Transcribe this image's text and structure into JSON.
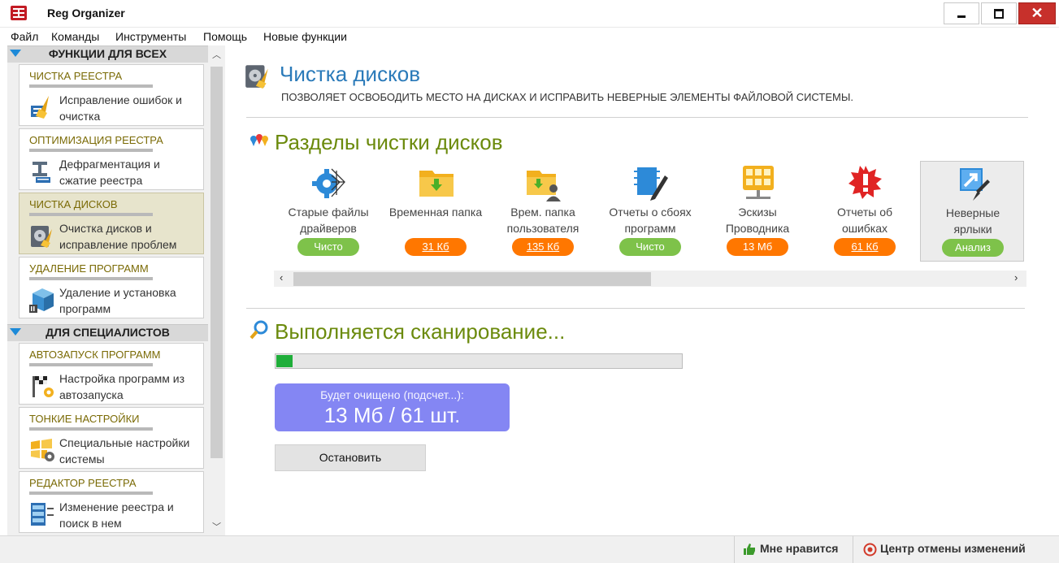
{
  "window": {
    "title": "Reg Organizer"
  },
  "menu": [
    "Файл",
    "Команды",
    "Инструменты",
    "Помощь",
    "Новые функции"
  ],
  "sidebar": {
    "section1": "ФУНКЦИИ ДЛЯ ВСЕХ",
    "section2": "ДЛЯ СПЕЦИАЛИСТОВ",
    "cards": [
      {
        "title": "ЧИСТКА РЕЕСТРА",
        "line1": "Исправление ошибок и",
        "line2": "очистка",
        "icon": "broom-registry-icon"
      },
      {
        "title": "ОПТИМИЗАЦИЯ РЕЕСТРА",
        "line1": "Дефрагментация и",
        "line2": "сжатие реестра",
        "icon": "compress-icon"
      },
      {
        "title": "ЧИСТКА ДИСКОВ",
        "line1": "Очистка дисков и",
        "line2": "исправление проблем",
        "icon": "disk-broom-icon"
      },
      {
        "title": "УДАЛЕНИЕ ПРОГРАММ",
        "line1": "Удаление и установка",
        "line2": "программ",
        "icon": "uninstall-box-icon"
      },
      {
        "title": "АВТОЗАПУСК ПРОГРАММ",
        "line1": "Настройка программ из",
        "line2": "автозапуска",
        "icon": "startup-flag-icon"
      },
      {
        "title": "ТОНКИЕ НАСТРОЙКИ",
        "line1": "Специальные настройки",
        "line2": "системы",
        "icon": "windows-gear-icon"
      },
      {
        "title": "РЕДАКТОР РЕЕСТРА",
        "line1": "Изменение реестра и",
        "line2": "поиск в нем",
        "icon": "registry-editor-icon"
      }
    ]
  },
  "main": {
    "title": "Чистка дисков",
    "subtitle": "ПОЗВОЛЯЕТ ОСВОБОДИТЬ МЕСТО НА ДИСКАХ И ИСПРАВИТЬ НЕВЕРНЫЕ ЭЛЕМЕНТЫ ФАЙЛОВОЙ СИСТЕМЫ.",
    "sections_title": "Разделы чистки дисков",
    "tiles": [
      {
        "line1": "Старые файлы",
        "line2": "драйверов",
        "status": "Чисто",
        "icon": "driver-gear-icon"
      },
      {
        "line1": "Временная папка",
        "line2": "",
        "status": "31 Кб",
        "icon": "temp-folder-icon"
      },
      {
        "line1": "Врем. папка",
        "line2": "пользователя",
        "status": "135 Кб",
        "icon": "user-folder-icon"
      },
      {
        "line1": "Отчеты о сбоях",
        "line2": "программ",
        "status": "Чисто",
        "icon": "crash-report-icon"
      },
      {
        "line1": "Эскизы",
        "line2": "Проводника",
        "status": "13 Мб",
        "icon": "thumbnails-icon"
      },
      {
        "line1": "Отчеты об",
        "line2": "ошибках",
        "status": "61 Кб",
        "icon": "error-report-icon"
      },
      {
        "line1": "Неверные",
        "line2": "ярлыки",
        "status": "Анализ",
        "icon": "shortcut-icon"
      }
    ],
    "scan_title": "Выполняется сканирование...",
    "progress": 0.04,
    "result_label": "Будет очищено (подсчет...):",
    "result_value": "13 Мб / 61 шт.",
    "stop_button": "Остановить"
  },
  "status": {
    "like": "Мне нравится",
    "undo_center": "Центр отмены изменений"
  },
  "colors": {
    "accent_blue": "#2a7ab9",
    "section_green": "#6b8a0c",
    "pill_green": "#7ec24a",
    "pill_orange": "#ff7700",
    "result_bg": "#8486f3",
    "progress_green": "#1fae3a"
  }
}
